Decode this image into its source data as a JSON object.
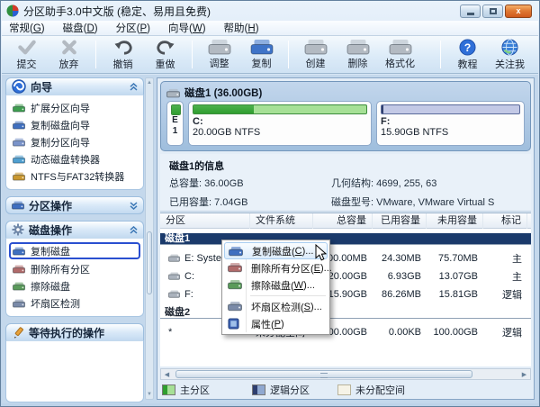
{
  "window": {
    "title": "分区助手3.0中文版 (稳定、易用且免费)",
    "close_glyph": "x"
  },
  "menubar": {
    "items": [
      {
        "pre": "常规(",
        "key": "G",
        "post": ")"
      },
      {
        "pre": "磁盘(",
        "key": "D",
        "post": ")"
      },
      {
        "pre": "分区(",
        "key": "P",
        "post": ")"
      },
      {
        "pre": "向导(",
        "key": "W",
        "post": ")"
      },
      {
        "pre": "帮助(",
        "key": "H",
        "post": ")"
      }
    ]
  },
  "toolbar": {
    "buttons": [
      {
        "label": "提交",
        "enabled": false
      },
      {
        "label": "放弃",
        "enabled": false
      },
      {
        "label": "撤销",
        "enabled": false
      },
      {
        "label": "重做",
        "enabled": false
      },
      {
        "label": "调整",
        "enabled": false
      },
      {
        "label": "复制",
        "enabled": true
      },
      {
        "label": "创建",
        "enabled": false
      },
      {
        "label": "删除",
        "enabled": false
      },
      {
        "label": "格式化",
        "enabled": false
      },
      {
        "label": "教程",
        "enabled": true
      },
      {
        "label": "关注我",
        "enabled": true
      }
    ]
  },
  "sidebar": {
    "sections": [
      {
        "title": "向导",
        "state": "expanded",
        "items": [
          "扩展分区向导",
          "复制磁盘向导",
          "复制分区向导",
          "动态磁盘转换器",
          "NTFS与FAT32转换器"
        ]
      },
      {
        "title": "分区操作",
        "state": "collapsed",
        "items": []
      },
      {
        "title": "磁盘操作",
        "state": "expanded",
        "selected_item": "复制磁盘",
        "items": [
          "复制磁盘",
          "删除所有分区",
          "擦除磁盘",
          "坏扇区检测"
        ]
      },
      {
        "title": "等待执行的操作",
        "state": "expanded",
        "items": []
      }
    ]
  },
  "disk_map": {
    "header": "磁盘1 (36.00GB)",
    "small_block": {
      "letter": "E",
      "number": "1"
    },
    "blocks": [
      {
        "name": "C:",
        "size": "20.00GB NTFS",
        "used_percent": 35,
        "type": "primary"
      },
      {
        "name": "F:",
        "size": "15.90GB NTFS",
        "used_percent": 1,
        "type": "logical"
      }
    ]
  },
  "disk_info": {
    "title": "磁盘1的信息",
    "total_label": "总容量: 36.00GB",
    "used_label": "已用容量: 7.04GB",
    "geometry_label": "几何结构: 4699, 255, 63",
    "model_label": "磁盘型号: VMware, VMware Virtual S"
  },
  "table": {
    "columns": [
      "分区",
      "文件系统",
      "总容量",
      "已用容量",
      "未用容量",
      "标记"
    ],
    "groups": [
      {
        "name": "磁盘1",
        "selected": true,
        "rows": [
          {
            "partition": "E: System",
            "fs": "",
            "total": "100.00MB",
            "used": "24.30MB",
            "free": "75.70MB",
            "mark": "主"
          },
          {
            "partition": "C:",
            "fs": "",
            "total": "20.00GB",
            "used": "6.93GB",
            "free": "13.07GB",
            "mark": "主"
          },
          {
            "partition": "F:",
            "fs": "",
            "total": "15.90GB",
            "used": "86.26MB",
            "free": "15.81GB",
            "mark": "逻辑"
          }
        ]
      },
      {
        "name": "磁盘2",
        "selected": false,
        "rows": [
          {
            "partition": "*",
            "fs": "未分配空间",
            "total": "100.00GB",
            "used": "0.00KB",
            "free": "100.00GB",
            "mark": "逻辑"
          }
        ]
      }
    ]
  },
  "context_menu": {
    "items": [
      {
        "pre": "复制磁盘(",
        "key": "C",
        "post": ")...",
        "highlighted": true
      },
      {
        "pre": "删除所有分区(",
        "key": "E",
        "post": ")..."
      },
      {
        "pre": "擦除磁盘(",
        "key": "W",
        "post": ")..."
      },
      {
        "pre": "坏扇区检测(",
        "key": "S",
        "post": ")..."
      },
      {
        "pre": "属性(",
        "key": "P",
        "post": ")"
      }
    ]
  },
  "legend": {
    "items": [
      {
        "label": "主分区",
        "color": "#2f9e2f"
      },
      {
        "label": "逻辑分区",
        "color": "#2e3e6e"
      },
      {
        "label": "未分配空间",
        "color": "#f6f3e7"
      }
    ]
  },
  "colors": {
    "selected_row": "#1b3a6b",
    "primary_green_dark": "#2f9e2f",
    "primary_green_light": "#a6e096",
    "logical_blue_dark": "#2e3e6e",
    "logical_blue_light": "#c3c9e6",
    "selection_border": "#2a4fd0",
    "close_button": "#cf5a1d"
  }
}
